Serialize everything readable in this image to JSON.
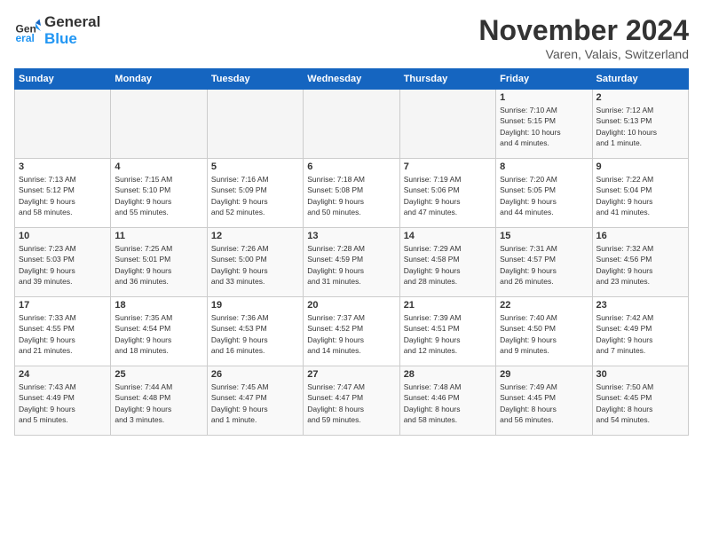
{
  "logo": {
    "line1": "General",
    "line2": "Blue"
  },
  "title": "November 2024",
  "subtitle": "Varen, Valais, Switzerland",
  "headers": [
    "Sunday",
    "Monday",
    "Tuesday",
    "Wednesday",
    "Thursday",
    "Friday",
    "Saturday"
  ],
  "weeks": [
    [
      {
        "day": "",
        "info": ""
      },
      {
        "day": "",
        "info": ""
      },
      {
        "day": "",
        "info": ""
      },
      {
        "day": "",
        "info": ""
      },
      {
        "day": "",
        "info": ""
      },
      {
        "day": "1",
        "info": "Sunrise: 7:10 AM\nSunset: 5:15 PM\nDaylight: 10 hours\nand 4 minutes."
      },
      {
        "day": "2",
        "info": "Sunrise: 7:12 AM\nSunset: 5:13 PM\nDaylight: 10 hours\nand 1 minute."
      }
    ],
    [
      {
        "day": "3",
        "info": "Sunrise: 7:13 AM\nSunset: 5:12 PM\nDaylight: 9 hours\nand 58 minutes."
      },
      {
        "day": "4",
        "info": "Sunrise: 7:15 AM\nSunset: 5:10 PM\nDaylight: 9 hours\nand 55 minutes."
      },
      {
        "day": "5",
        "info": "Sunrise: 7:16 AM\nSunset: 5:09 PM\nDaylight: 9 hours\nand 52 minutes."
      },
      {
        "day": "6",
        "info": "Sunrise: 7:18 AM\nSunset: 5:08 PM\nDaylight: 9 hours\nand 50 minutes."
      },
      {
        "day": "7",
        "info": "Sunrise: 7:19 AM\nSunset: 5:06 PM\nDaylight: 9 hours\nand 47 minutes."
      },
      {
        "day": "8",
        "info": "Sunrise: 7:20 AM\nSunset: 5:05 PM\nDaylight: 9 hours\nand 44 minutes."
      },
      {
        "day": "9",
        "info": "Sunrise: 7:22 AM\nSunset: 5:04 PM\nDaylight: 9 hours\nand 41 minutes."
      }
    ],
    [
      {
        "day": "10",
        "info": "Sunrise: 7:23 AM\nSunset: 5:03 PM\nDaylight: 9 hours\nand 39 minutes."
      },
      {
        "day": "11",
        "info": "Sunrise: 7:25 AM\nSunset: 5:01 PM\nDaylight: 9 hours\nand 36 minutes."
      },
      {
        "day": "12",
        "info": "Sunrise: 7:26 AM\nSunset: 5:00 PM\nDaylight: 9 hours\nand 33 minutes."
      },
      {
        "day": "13",
        "info": "Sunrise: 7:28 AM\nSunset: 4:59 PM\nDaylight: 9 hours\nand 31 minutes."
      },
      {
        "day": "14",
        "info": "Sunrise: 7:29 AM\nSunset: 4:58 PM\nDaylight: 9 hours\nand 28 minutes."
      },
      {
        "day": "15",
        "info": "Sunrise: 7:31 AM\nSunset: 4:57 PM\nDaylight: 9 hours\nand 26 minutes."
      },
      {
        "day": "16",
        "info": "Sunrise: 7:32 AM\nSunset: 4:56 PM\nDaylight: 9 hours\nand 23 minutes."
      }
    ],
    [
      {
        "day": "17",
        "info": "Sunrise: 7:33 AM\nSunset: 4:55 PM\nDaylight: 9 hours\nand 21 minutes."
      },
      {
        "day": "18",
        "info": "Sunrise: 7:35 AM\nSunset: 4:54 PM\nDaylight: 9 hours\nand 18 minutes."
      },
      {
        "day": "19",
        "info": "Sunrise: 7:36 AM\nSunset: 4:53 PM\nDaylight: 9 hours\nand 16 minutes."
      },
      {
        "day": "20",
        "info": "Sunrise: 7:37 AM\nSunset: 4:52 PM\nDaylight: 9 hours\nand 14 minutes."
      },
      {
        "day": "21",
        "info": "Sunrise: 7:39 AM\nSunset: 4:51 PM\nDaylight: 9 hours\nand 12 minutes."
      },
      {
        "day": "22",
        "info": "Sunrise: 7:40 AM\nSunset: 4:50 PM\nDaylight: 9 hours\nand 9 minutes."
      },
      {
        "day": "23",
        "info": "Sunrise: 7:42 AM\nSunset: 4:49 PM\nDaylight: 9 hours\nand 7 minutes."
      }
    ],
    [
      {
        "day": "24",
        "info": "Sunrise: 7:43 AM\nSunset: 4:49 PM\nDaylight: 9 hours\nand 5 minutes."
      },
      {
        "day": "25",
        "info": "Sunrise: 7:44 AM\nSunset: 4:48 PM\nDaylight: 9 hours\nand 3 minutes."
      },
      {
        "day": "26",
        "info": "Sunrise: 7:45 AM\nSunset: 4:47 PM\nDaylight: 9 hours\nand 1 minute."
      },
      {
        "day": "27",
        "info": "Sunrise: 7:47 AM\nSunset: 4:47 PM\nDaylight: 8 hours\nand 59 minutes."
      },
      {
        "day": "28",
        "info": "Sunrise: 7:48 AM\nSunset: 4:46 PM\nDaylight: 8 hours\nand 58 minutes."
      },
      {
        "day": "29",
        "info": "Sunrise: 7:49 AM\nSunset: 4:45 PM\nDaylight: 8 hours\nand 56 minutes."
      },
      {
        "day": "30",
        "info": "Sunrise: 7:50 AM\nSunset: 4:45 PM\nDaylight: 8 hours\nand 54 minutes."
      }
    ]
  ]
}
